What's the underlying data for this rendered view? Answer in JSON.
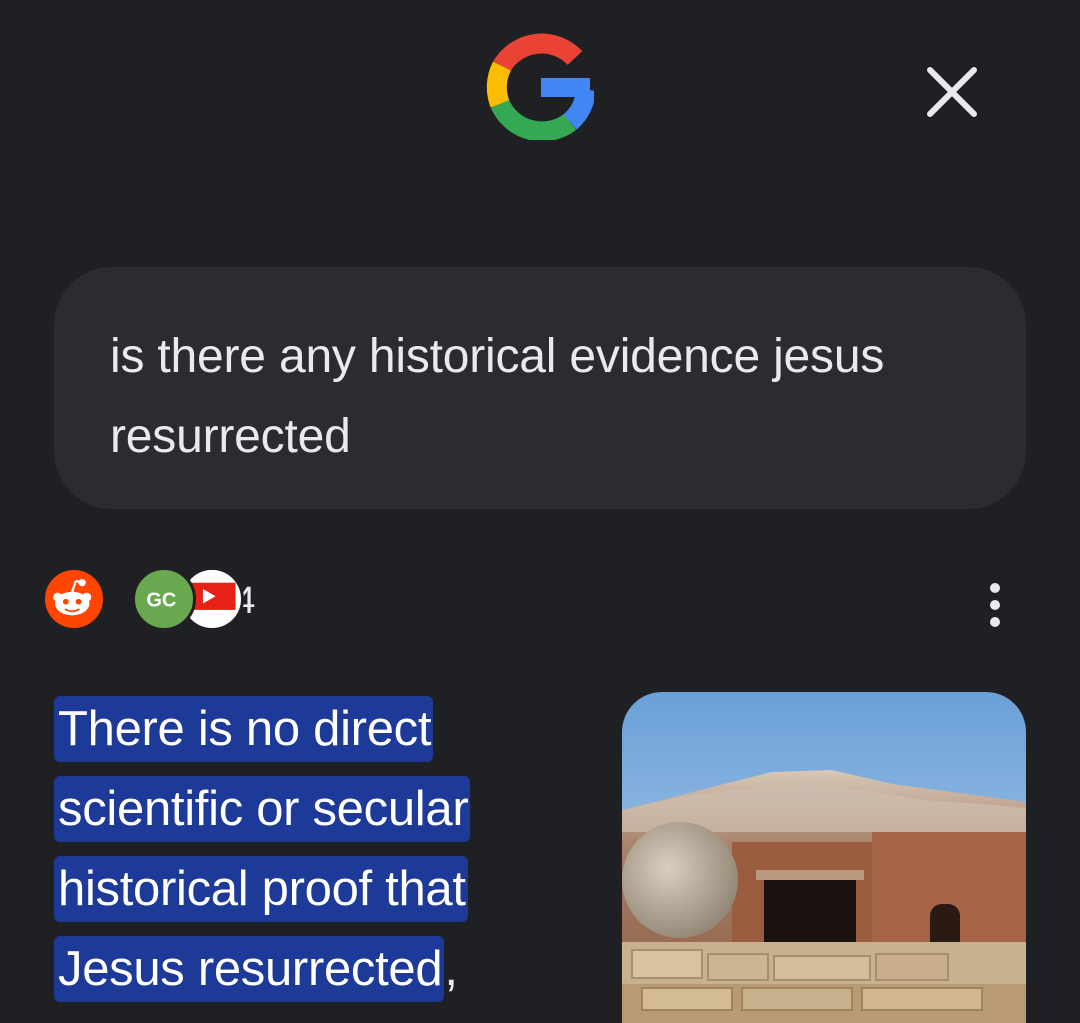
{
  "header": {
    "logo_icon": "google-g-icon",
    "close_icon": "close-icon"
  },
  "query": {
    "text": "is there any historical evidence jesus resurrected"
  },
  "sources": {
    "icons": [
      "reddit-icon",
      "gc-icon",
      "youtube-icon"
    ],
    "gc_label": "GC",
    "more_count": "+4"
  },
  "menu": {
    "icon": "more-vert-icon"
  },
  "answer": {
    "lines": [
      "There is no direct",
      "scientific or secular",
      "historical proof that",
      "Jesus resurrected"
    ],
    "trailing": ","
  },
  "image": {
    "subject": "stone-tomb-image"
  },
  "colors": {
    "background": "#1f2023",
    "bubble": "#2b2c30",
    "highlight": "#1e3a99",
    "text": "#e8eaed"
  }
}
